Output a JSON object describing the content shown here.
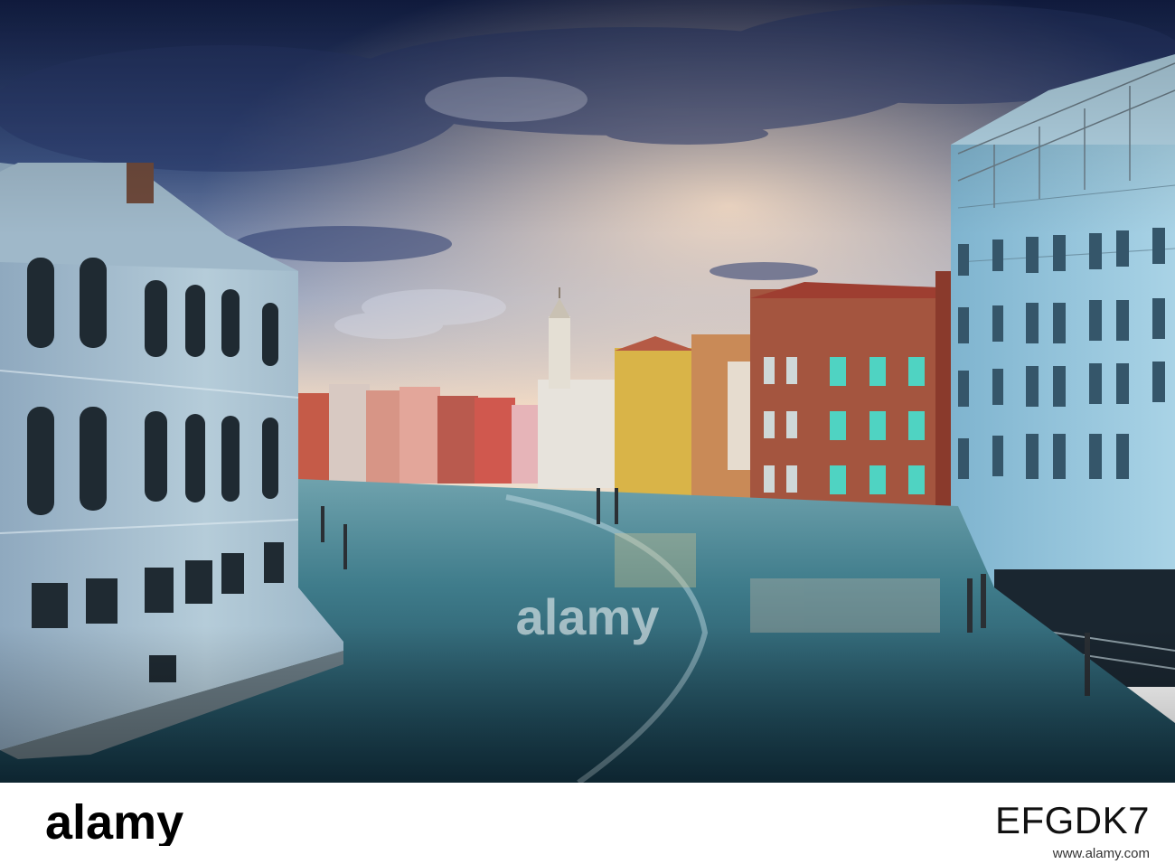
{
  "photo": {
    "subject": "grand-canal-venice",
    "colors": {
      "sky_top": "#1f2f63",
      "sky_mid": "#5a6fa0",
      "sky_glow": "#f3d8c0",
      "water": "#3e7b8c",
      "water_dark": "#1d4a5c",
      "left_palace": "#b9cfdc",
      "right_building": "#9cc6dc",
      "brick": "#a8553f",
      "ochre": "#d8b24a",
      "teal_shutters": "#4fd3c2"
    }
  },
  "watermark": {
    "text": "alamy"
  },
  "footer": {
    "logo_text": "alamy",
    "image_id": "EFGDK7",
    "url": "www.alamy.com"
  }
}
